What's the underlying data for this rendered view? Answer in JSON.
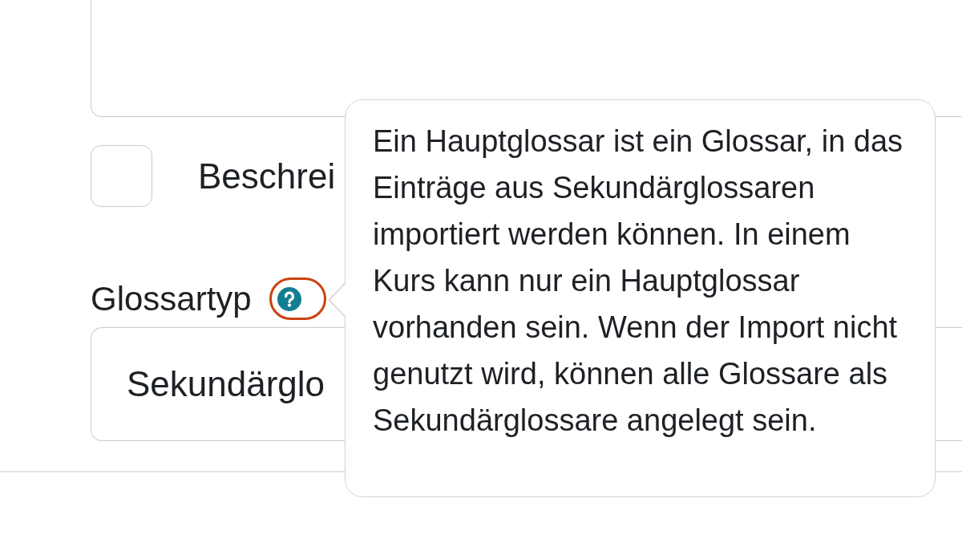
{
  "checkbox": {
    "label": "Beschrei",
    "checked": false
  },
  "glossary_type": {
    "label": "Glossartyp",
    "help_button": {
      "focused": true
    },
    "select": {
      "value": "Sekundärglo"
    }
  },
  "tooltip": {
    "text": "Ein Hauptglossar ist ein Glossar, in das Einträge aus Sekundärglossaren importiert werden können. In einem Kurs kann nur ein Hauptglossar vorhanden sein. Wenn der Import nicht genutzt wird, können alle Glossare als Sekundärglossare angelegt sein."
  }
}
